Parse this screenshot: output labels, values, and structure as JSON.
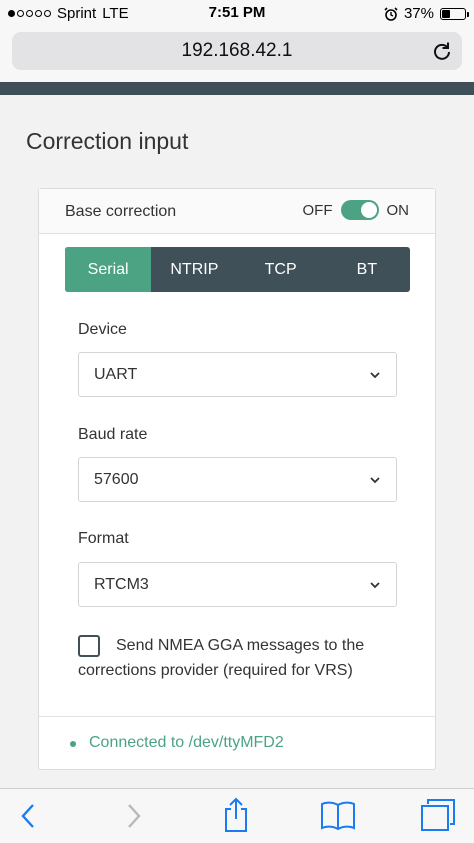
{
  "status_bar": {
    "carrier": "Sprint",
    "network": "LTE",
    "time": "7:51 PM",
    "battery": "37%",
    "battery_level": 0.37,
    "signal_bars": 1,
    "signal_total": 5
  },
  "browser": {
    "url": "192.168.42.1",
    "icons": [
      "reload-icon",
      "back-icon",
      "forward-icon",
      "share-icon",
      "bookmarks-icon",
      "tabs-icon"
    ]
  },
  "page": {
    "title": "Correction input"
  },
  "card": {
    "header_label": "Base correction",
    "toggle_off_label": "OFF",
    "toggle_on_label": "ON",
    "toggle_state": "on",
    "tabs": [
      {
        "label": "Serial",
        "active": true
      },
      {
        "label": "NTRIP",
        "active": false
      },
      {
        "label": "TCP",
        "active": false
      },
      {
        "label": "BT",
        "active": false
      }
    ],
    "device": {
      "label": "Device",
      "value": "UART"
    },
    "baud_rate": {
      "label": "Baud rate",
      "value": "57600"
    },
    "format": {
      "label": "Format",
      "value": "RTCM3"
    },
    "nmea_checkbox": {
      "label": "Send NMEA GGA messages to the corrections provider (required for VRS)",
      "checked": false
    },
    "status": "Connected to /dev/ttyMFD2"
  },
  "colors": {
    "accent": "#4ca383",
    "dark": "#3f5059",
    "ios_blue": "#1a7cf0"
  }
}
